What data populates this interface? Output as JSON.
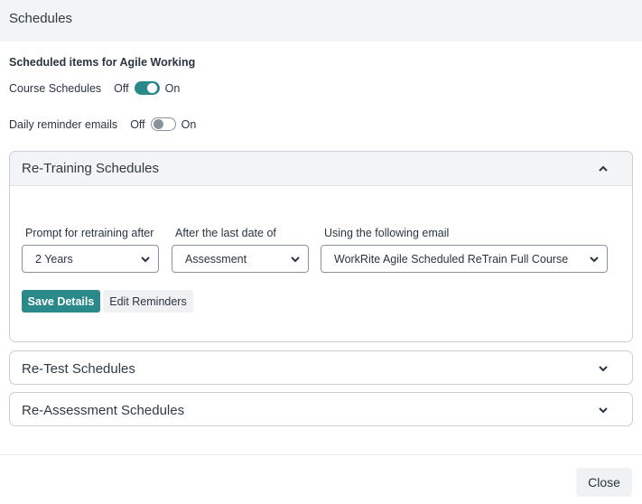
{
  "dialog": {
    "title": "Schedules"
  },
  "subtitle": "Scheduled items for Agile Working",
  "toggles": [
    {
      "label": "Course Schedules",
      "off_label": "Off",
      "on_label": "On",
      "state": "on"
    },
    {
      "label": "Daily reminder emails",
      "off_label": "Off",
      "on_label": "On",
      "state": "off"
    }
  ],
  "accent_color": "#2a8a8a",
  "retraining": {
    "title": "Re-Training Schedules",
    "expanded": true,
    "fields": {
      "prompt_label": "Prompt for retraining after",
      "prompt_value": "2 Years",
      "last_date_label": "After the last date of",
      "last_date_value": "Assessment",
      "email_label": "Using the following email",
      "email_value": "WorkRite Agile Scheduled ReTrain Full Course"
    },
    "save_label": "Save Details",
    "edit_label": "Edit Reminders"
  },
  "retest": {
    "title": "Re-Test Schedules",
    "expanded": false
  },
  "reassessment": {
    "title": "Re-Assessment Schedules",
    "expanded": false
  },
  "footer": {
    "close_label": "Close"
  }
}
